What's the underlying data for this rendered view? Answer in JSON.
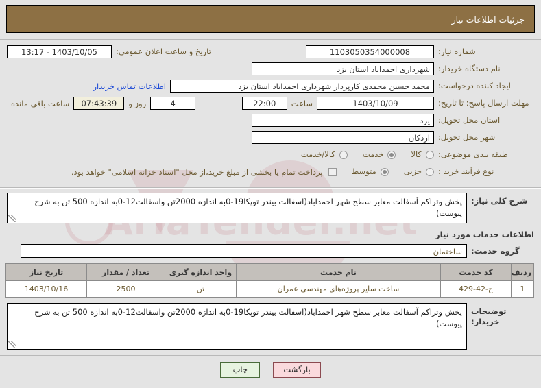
{
  "header": {
    "title": "جزئیات اطلاعات نیاز"
  },
  "form": {
    "need_number": {
      "label": "شماره نیاز:",
      "value": "1103050354000008"
    },
    "announce": {
      "label": "تاریخ و ساعت اعلان عمومی:",
      "value": "1403/10/05 - 13:17"
    },
    "buyer_org": {
      "label": "نام دستگاه خریدار:",
      "value": "شهرداری احمداباد استان یزد"
    },
    "requester": {
      "label": "ایجاد کننده درخواست:",
      "value": "محمد حسین محمدی کارپرداز شهرداری احمداباد استان یزد"
    },
    "contact_link": "اطلاعات تماس خریدار",
    "deadline": {
      "label": "مهلت ارسال پاسخ: تا تاریخ:",
      "date": "1403/10/09",
      "hour_label": "ساعت",
      "hour": "22:00",
      "days": "4",
      "days_label": "روز و",
      "countdown": "07:43:39",
      "countdown_label": "ساعت باقی مانده"
    },
    "province": {
      "label": "استان محل تحویل:",
      "value": "یزد"
    },
    "city": {
      "label": "شهر محل تحویل:",
      "value": "اردکان"
    },
    "category": {
      "label": "طبقه بندی موضوعی:",
      "options": [
        {
          "text": "کالا",
          "selected": false
        },
        {
          "text": "خدمت",
          "selected": true
        },
        {
          "text": "کالا/خدمت",
          "selected": false
        }
      ]
    },
    "process_type": {
      "label": "نوع فرآیند خرید :",
      "options": [
        {
          "text": "جزیی",
          "selected": false
        },
        {
          "text": "متوسط",
          "selected": true
        }
      ],
      "checkbox_text": "پرداخت تمام یا بخشی از مبلغ خرید،از محل \"اسناد خزانه اسلامی\" خواهد بود.",
      "checkbox_checked": false
    }
  },
  "description": {
    "label": "شرح کلی نیاز:",
    "value": "پخش وتراکم آسفالت معابر سطح شهر احمداباد(اسفالت بیندر توپکا19-0به اندازه 2000تن واسفالت12-0به اندازه 500 تن به شرح پیوست)"
  },
  "services_section": {
    "title": "اطلاعات خدمات مورد نیاز",
    "group": {
      "label": "گروه خدمت:",
      "value": "ساختمان"
    }
  },
  "table": {
    "columns": [
      "ردیف",
      "کد خدمت",
      "نام خدمت",
      "واحد اندازه گیری",
      "تعداد / مقدار",
      "تاریخ نیاز"
    ],
    "rows": [
      {
        "radif": "1",
        "code": "ج-42-429",
        "name": "ساخت سایر پروژه‌های مهندسی عمران",
        "unit": "تن",
        "qty": "2500",
        "date": "1403/10/16"
      }
    ]
  },
  "buyer_notes": {
    "label": "توضیحات خریدار:",
    "value": "پخش وتراکم آسفالت معابر سطح شهر احمداباد(اسفالت بیندر توپکا19-0به اندازه 2000تن واسفالت12-0به اندازه 500 تن به شرح پیوست)"
  },
  "footer": {
    "back_button": "بازگشت",
    "print_button": "چاپ"
  },
  "watermark": {
    "text": "AriaTender.net"
  },
  "colors": {
    "header_bg": "#8d7044",
    "label": "#6b5a32",
    "link": "#1e4bd6",
    "table_header_bg": "#c4c0bb",
    "back_btn_bg": "#fadadd",
    "print_btn_bg": "#e7f3e0",
    "highlight": "#f2efdc"
  }
}
